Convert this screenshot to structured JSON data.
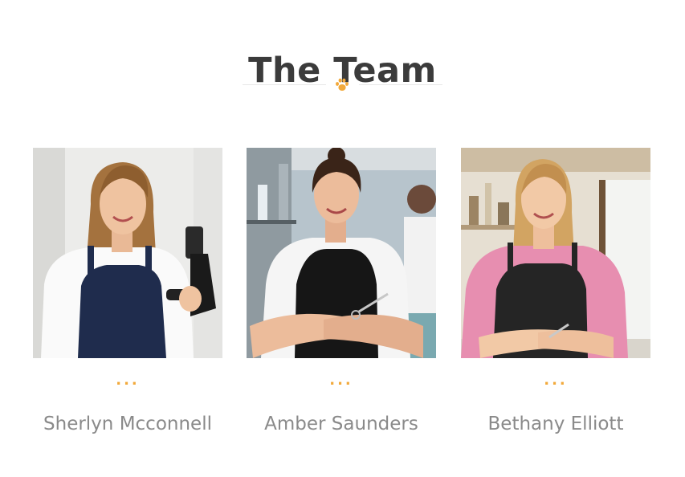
{
  "section": {
    "title": "The Team",
    "divider_icon": "paw-icon"
  },
  "colors": {
    "accent": "#f2a93b",
    "title": "#3b3b3b",
    "name": "#8a8a8a"
  },
  "team": {
    "members": [
      {
        "name": "Sherlyn Mcconnell",
        "dots": "...",
        "photo_icon": "stylist-with-hairdryer-photo"
      },
      {
        "name": "Amber Saunders",
        "dots": "...",
        "photo_icon": "stylist-with-scissors-photo"
      },
      {
        "name": "Bethany Elliott",
        "dots": "...",
        "photo_icon": "stylist-pink-shirt-photo"
      }
    ]
  }
}
